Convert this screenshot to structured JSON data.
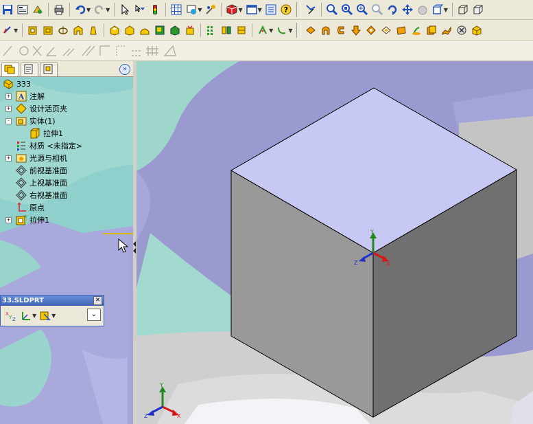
{
  "tree": {
    "root": "333",
    "items": [
      {
        "label": "注解",
        "expander": "+"
      },
      {
        "label": "设计活页夹",
        "expander": "+"
      },
      {
        "label": "实体(1)",
        "expander": "-"
      },
      {
        "label": "拉伸1",
        "expander": ""
      },
      {
        "label": "材质 <未指定>",
        "expander": ""
      },
      {
        "label": "光源与相机",
        "expander": "+"
      },
      {
        "label": "前视基准面",
        "expander": ""
      },
      {
        "label": "上视基准面",
        "expander": ""
      },
      {
        "label": "右视基准面",
        "expander": ""
      },
      {
        "label": "原点",
        "expander": ""
      },
      {
        "label": "拉伸1",
        "expander": "+"
      }
    ]
  },
  "property_manager": {
    "title": "33.SLDPRT",
    "close_glyph": "✕",
    "more_glyph": "⌄"
  },
  "panel": {
    "collapse_glyph": "»"
  },
  "triad": {
    "x_label": "X",
    "y_label": "Y",
    "z_label": "Z"
  },
  "colors": {
    "cube_top": "#c8c8f4",
    "cube_left": "#999999",
    "cube_right": "#707070",
    "axis_x": "#d81818",
    "axis_y": "#1f8a1f",
    "axis_z": "#2030c8"
  },
  "icons": {
    "toolbar1": [
      "save-icon",
      "properties-icon",
      "rebuild-icon",
      "print-icon",
      "undo-icon",
      "redo-icon",
      "select-icon",
      "selection-filter-icon",
      "traffic-light-icon",
      "grid-icon",
      "options-icon",
      "appearance-icon",
      "cube-display-icon",
      "view-icon",
      "list-icon",
      "help-icon",
      "sketch-icon",
      "zoom-fit-icon",
      "zoom-area-icon",
      "zoom-in-out-icon",
      "zoom-selection-icon",
      "rotate-icon",
      "pan-icon",
      "hidden-icon",
      "display-style-icon",
      "box-icon",
      "shaded-box-icon"
    ],
    "toolbar2": [
      "origin-icon",
      "extrude-boss-icon",
      "revolve-icon",
      "sweep-icon",
      "loft-icon",
      "dome-icon",
      "extrude-cut-icon",
      "revolve-cut-icon",
      "cut-sweep-icon",
      "cut-loft-icon",
      "hole-icon",
      "linear-pattern-icon",
      "mirror-icon",
      "reference-icon",
      "curve-icon",
      "fillet-icon",
      "chamfer-icon",
      "rib-icon",
      "shell-icon",
      "draft-icon",
      "wrap-icon",
      "intersect-icon",
      "scale-icon",
      "flex-icon",
      "deform-icon",
      "split-icon",
      "combine-icon"
    ],
    "toolbar3": [
      "line-icon",
      "circle-icon",
      "cross-icon",
      "angle-icon",
      "parallel-icon",
      "slash-icon",
      "corner-icon",
      "dotted-corner-icon",
      "dashed-line-icon",
      "grid-icon",
      "angle-measure-icon"
    ]
  }
}
